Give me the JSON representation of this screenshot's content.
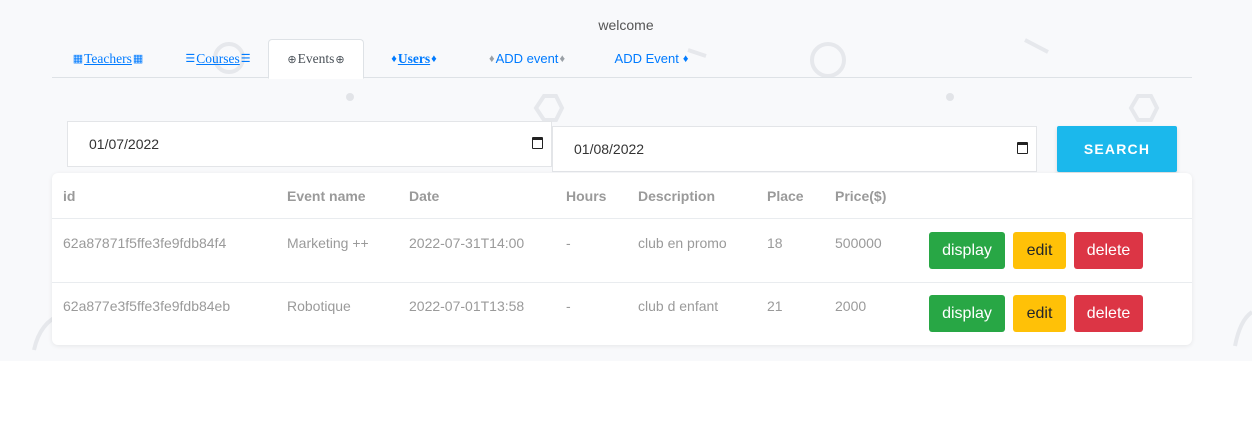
{
  "header": {
    "welcome": "welcome"
  },
  "tabs": [
    {
      "label": "Teachers",
      "icon_left": "table-icon",
      "icon_right": "table-icon",
      "glyph": "▦"
    },
    {
      "label": "Courses",
      "icon_left": "align-center-icon",
      "icon_right": "align-center-icon",
      "glyph": "☰"
    },
    {
      "label": "Events",
      "icon_left": "globe-icon",
      "icon_right": "globe-icon",
      "glyph": "⊕",
      "active": true
    },
    {
      "label": "Users",
      "icon_left": "diamond-icon",
      "icon_right": "diamond-icon",
      "glyph": "♦"
    },
    {
      "label": "ADD event",
      "icon_left": "diamond-icon",
      "icon_right": "diamond-icon",
      "glyph": "♦"
    },
    {
      "label": "ADD Event",
      "icon_right": "diamond-icon",
      "glyph": "♦"
    }
  ],
  "filters": {
    "start_date": "01/07/2022",
    "end_date": "01/08/2022",
    "search_label": "SEARCH"
  },
  "table": {
    "columns": [
      "id",
      "Event name",
      "Date",
      "Hours",
      "Description",
      "Place",
      "Price($)"
    ],
    "rows": [
      {
        "id": "62a87871f5ffe3fe9fdb84f4",
        "name": "Marketing ++",
        "date": "2022-07-31T14:00",
        "hours": "-",
        "description": "club en promo",
        "place": "18",
        "price": "500000"
      },
      {
        "id": "62a877e3f5ffe3fe9fdb84eb",
        "name": "Robotique",
        "date": "2022-07-01T13:58",
        "hours": "-",
        "description": "club d enfant",
        "place": "21",
        "price": "2000"
      }
    ],
    "actions": {
      "display": "display",
      "edit": "edit",
      "delete": "delete"
    }
  },
  "colors": {
    "accent": "#007bff",
    "search": "#1bb8ec",
    "display": "#28a745",
    "edit": "#ffc107",
    "delete": "#dc3545"
  }
}
